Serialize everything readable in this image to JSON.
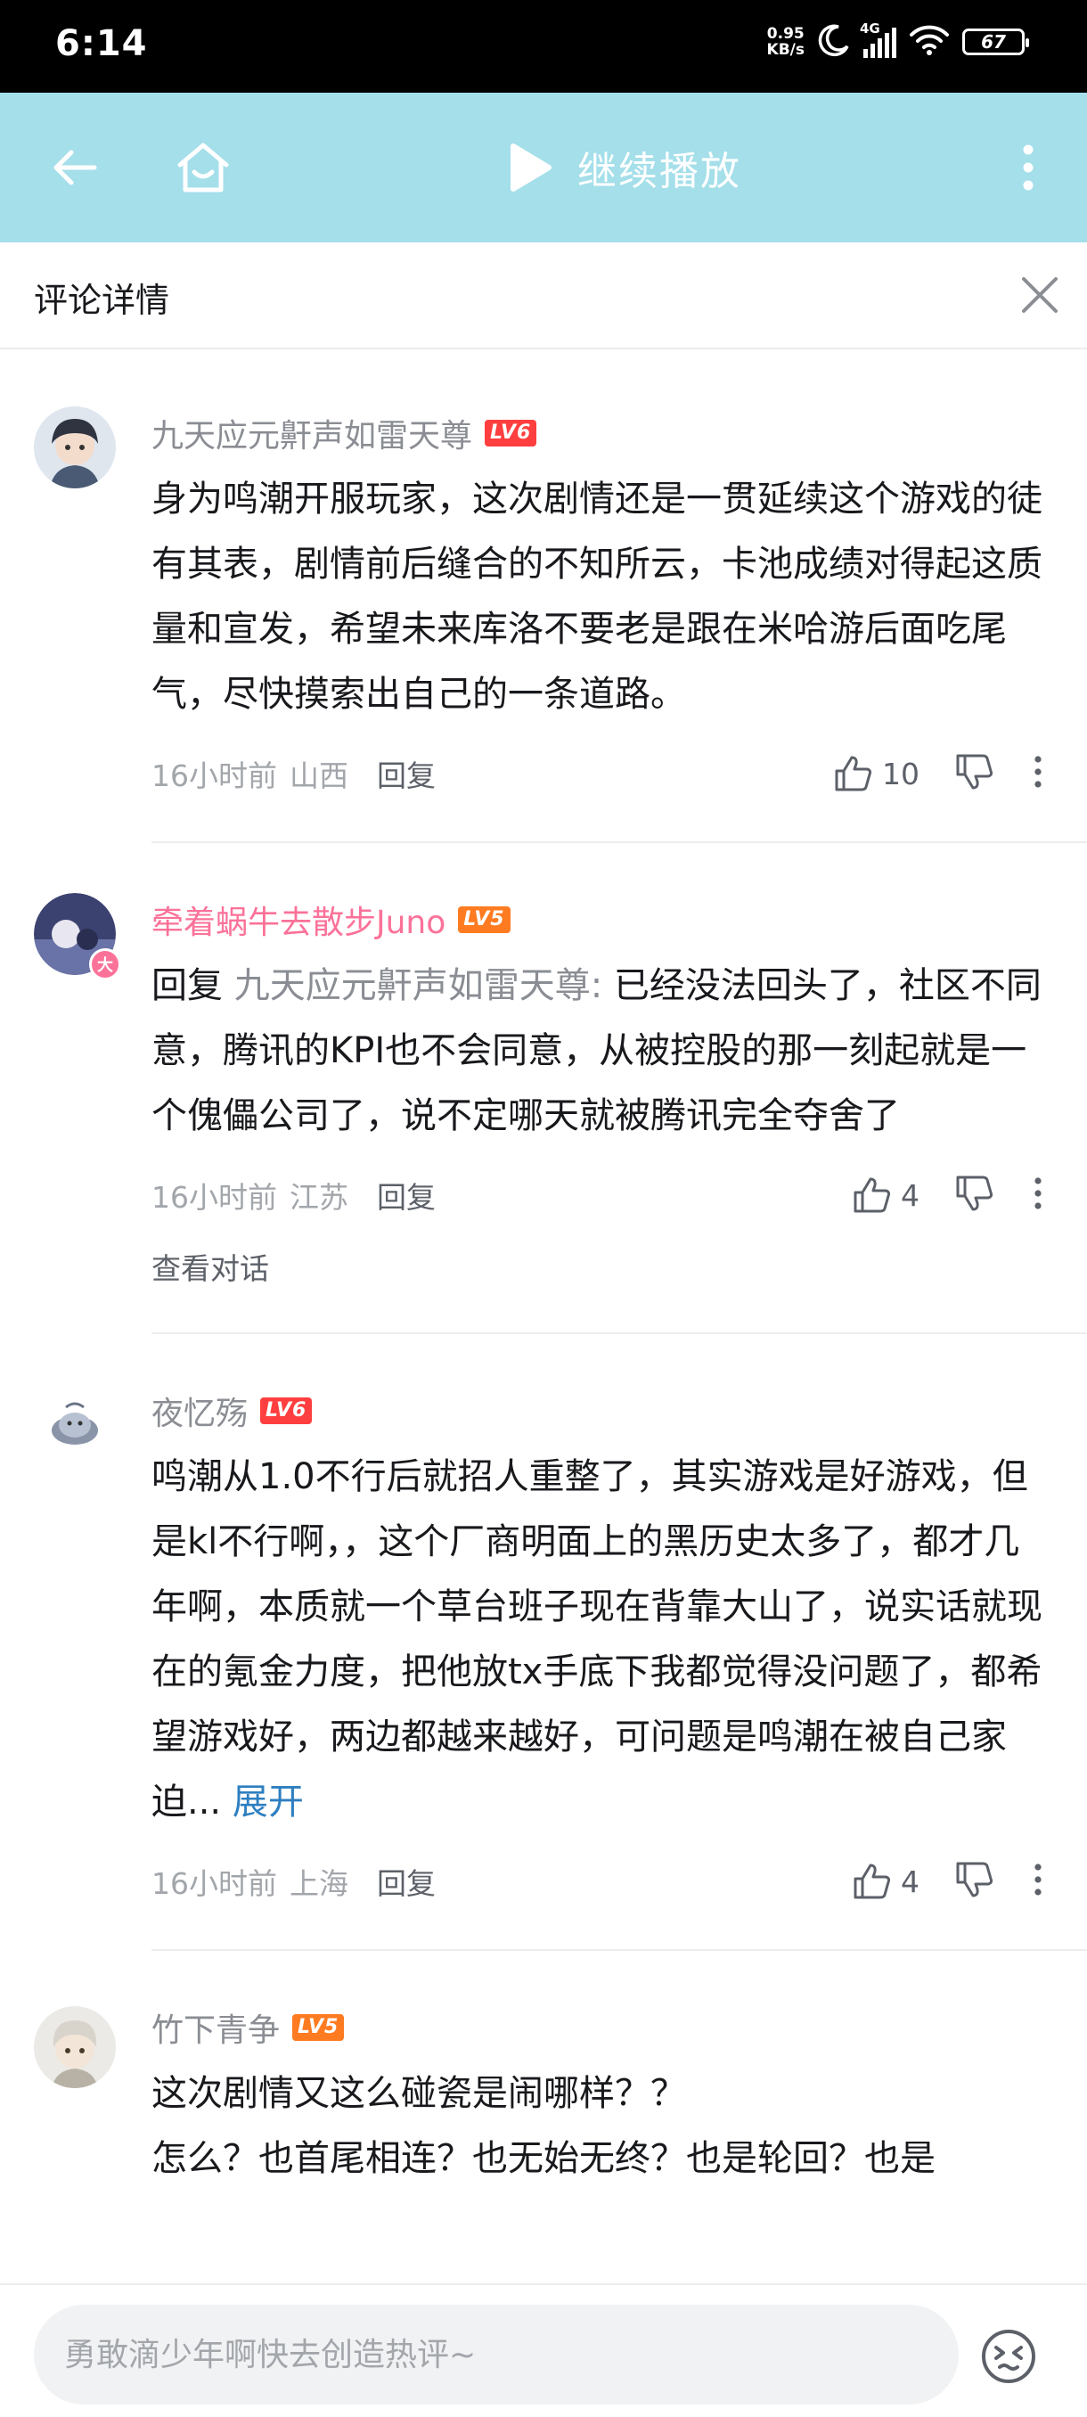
{
  "status_bar": {
    "time": "6:14",
    "net_speed_value": "0.95",
    "net_speed_unit": "KB/s",
    "network": "4G",
    "battery": "67"
  },
  "nav": {
    "play_label": "继续播放"
  },
  "detail": {
    "title": "评论详情"
  },
  "comments": [
    {
      "username": "九天应元鼾声如雷天尊",
      "level": "LV6",
      "content": "身为鸣潮开服玩家，这次剧情还是一贯延续这个游戏的徒有其表，剧情前后缝合的不知所云，卡池成绩对得起这质量和宣发，希望未来库洛不要老是跟在米哈游后面吃尾气，尽快摸索出自己的一条道路。",
      "time": "16小时前",
      "location": "山西",
      "reply_label": "回复",
      "likes": "10"
    },
    {
      "username": "牵着蜗牛去散步Juno",
      "level": "LV5",
      "reply_prefix": "回复",
      "reply_to": "九天应元鼾声如雷天尊:",
      "content": "已经没法回头了，社区不同意，腾讯的KPI也不会同意，从被控股的那一刻起就是一个傀儡公司了，说不定哪天就被腾讯完全夺舍了",
      "time": "16小时前",
      "location": "江苏",
      "reply_label": "回复",
      "likes": "4",
      "view_conversation": "查看对话",
      "avatar_badge": "大"
    },
    {
      "username": "夜忆殇",
      "level": "LV6",
      "content": "鸣潮从1.0不行后就招人重整了，其实游戏是好游戏，但是kl不行啊，，这个厂商明面上的黑历史太多了，都才几年啊，本质就一个草台班子现在背靠大山了，说实话就现在的氪金力度，把他放tx手底下我都觉得没问题了，都希望游戏好，两边都越来越好，可问题是鸣潮在被自己家迫...",
      "expand_label": "展开",
      "time": "16小时前",
      "location": "上海",
      "reply_label": "回复",
      "likes": "4"
    },
    {
      "username": "竹下青争",
      "level": "LV5",
      "content_line1": "这次剧情又这么碰瓷是闹哪样？？",
      "content_line2": "怎么？也首尾相连？也无始无终？也是轮回？也是"
    }
  ],
  "bottom_bar": {
    "placeholder": "勇敢滴少年啊快去创造热评~"
  },
  "colors": {
    "nav_bg": "#a4dfea",
    "username_pink": "#fb7299",
    "level6": "#ff3f3f",
    "level5": "#ff7b21",
    "expand_link": "#2e7fc0"
  }
}
